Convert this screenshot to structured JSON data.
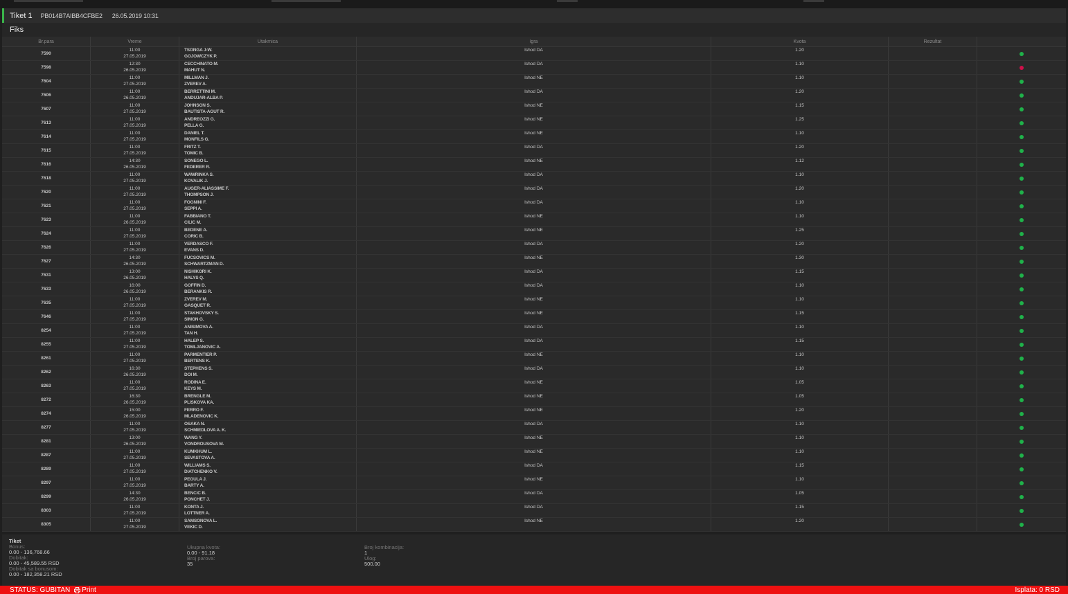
{
  "ticket": {
    "title": "Tiket 1",
    "code": "PB014B7AIBB4CFBE2",
    "date": "26.05.2019 10:31",
    "section": "Fiks"
  },
  "columns": [
    "Br.para",
    "Vreme",
    "Utakmica",
    "Igra",
    "Kvota",
    "Rezultat",
    ""
  ],
  "rows": [
    {
      "num": "7590",
      "time": "11:00",
      "date": "27.05.2019",
      "p1": "TSONGA J-W.",
      "p2": "GOJOWCZYK P.",
      "game": "Ishod DA",
      "odds": "1.20",
      "result": "won"
    },
    {
      "num": "7598",
      "time": "12:30",
      "date": "26.05.2019",
      "p1": "CECCHINATO M.",
      "p2": "MAHUT N.",
      "game": "Ishod DA",
      "odds": "1.10",
      "result": "lost"
    },
    {
      "num": "7604",
      "time": "11:00",
      "date": "27.05.2019",
      "p1": "MILLMAN J.",
      "p2": "ZVEREV A.",
      "game": "Ishod NE",
      "odds": "1.10",
      "result": "won"
    },
    {
      "num": "7606",
      "time": "11:00",
      "date": "26.05.2019",
      "p1": "BERRETTINI M.",
      "p2": "ANDUJAR-ALBA P.",
      "game": "Ishod DA",
      "odds": "1.20",
      "result": "won"
    },
    {
      "num": "7607",
      "time": "11:00",
      "date": "27.05.2019",
      "p1": "JOHNSON S.",
      "p2": "BAUTISTA-AGUT R.",
      "game": "Ishod NE",
      "odds": "1.15",
      "result": "won"
    },
    {
      "num": "7613",
      "time": "11:00",
      "date": "27.05.2019",
      "p1": "ANDREOZZI G.",
      "p2": "PELLA G.",
      "game": "Ishod NE",
      "odds": "1.25",
      "result": "won"
    },
    {
      "num": "7614",
      "time": "11:00",
      "date": "27.05.2019",
      "p1": "DANIEL T.",
      "p2": "MONFILS G.",
      "game": "Ishod NE",
      "odds": "1.10",
      "result": "won"
    },
    {
      "num": "7615",
      "time": "11:00",
      "date": "27.05.2019",
      "p1": "FRITZ T.",
      "p2": "TOMIC B.",
      "game": "Ishod DA",
      "odds": "1.20",
      "result": "won"
    },
    {
      "num": "7616",
      "time": "14:30",
      "date": "26.05.2019",
      "p1": "SONEGO L.",
      "p2": "FEDERER R.",
      "game": "Ishod NE",
      "odds": "1.12",
      "result": "won"
    },
    {
      "num": "7618",
      "time": "11:00",
      "date": "27.05.2019",
      "p1": "WAWRINKA S.",
      "p2": "KOVALIK J.",
      "game": "Ishod DA",
      "odds": "1.10",
      "result": "won"
    },
    {
      "num": "7620",
      "time": "11:00",
      "date": "27.05.2019",
      "p1": "AUGER-ALIASSIME F.",
      "p2": "THOMPSON J.",
      "game": "Ishod DA",
      "odds": "1.20",
      "result": "won"
    },
    {
      "num": "7621",
      "time": "11:00",
      "date": "27.05.2019",
      "p1": "FOGNINI F.",
      "p2": "SEPPI A.",
      "game": "Ishod DA",
      "odds": "1.10",
      "result": "won"
    },
    {
      "num": "7623",
      "time": "11:00",
      "date": "26.05.2019",
      "p1": "FABBIANO T.",
      "p2": "CILIC M.",
      "game": "Ishod NE",
      "odds": "1.10",
      "result": "won"
    },
    {
      "num": "7624",
      "time": "11:00",
      "date": "27.05.2019",
      "p1": "BEDENE A.",
      "p2": "CORIC B.",
      "game": "Ishod NE",
      "odds": "1.25",
      "result": "won"
    },
    {
      "num": "7626",
      "time": "11:00",
      "date": "27.05.2019",
      "p1": "VERDASCO F.",
      "p2": "EVANS D.",
      "game": "Ishod DA",
      "odds": "1.20",
      "result": "won"
    },
    {
      "num": "7627",
      "time": "14:30",
      "date": "26.05.2019",
      "p1": "FUCSOVICS M.",
      "p2": "SCHWARTZMAN D.",
      "game": "Ishod NE",
      "odds": "1.30",
      "result": "won"
    },
    {
      "num": "7631",
      "time": "13:00",
      "date": "26.05.2019",
      "p1": "NISHIKORI K.",
      "p2": "HALYS Q.",
      "game": "Ishod DA",
      "odds": "1.15",
      "result": "won"
    },
    {
      "num": "7633",
      "time": "16:00",
      "date": "26.05.2019",
      "p1": "GOFFIN D.",
      "p2": "BERANKIS R.",
      "game": "Ishod DA",
      "odds": "1.10",
      "result": "won"
    },
    {
      "num": "7635",
      "time": "11:00",
      "date": "27.05.2019",
      "p1": "ZVEREV M.",
      "p2": "GASQUET R.",
      "game": "Ishod NE",
      "odds": "1.10",
      "result": "won"
    },
    {
      "num": "7646",
      "time": "11:00",
      "date": "27.05.2019",
      "p1": "STAKHOVSKY S.",
      "p2": "SIMON G.",
      "game": "Ishod NE",
      "odds": "1.15",
      "result": "won"
    },
    {
      "num": "8254",
      "time": "11:00",
      "date": "27.05.2019",
      "p1": "ANISIMOVA A.",
      "p2": "TAN H.",
      "game": "Ishod DA",
      "odds": "1.10",
      "result": "won"
    },
    {
      "num": "8255",
      "time": "11:00",
      "date": "27.05.2019",
      "p1": "HALEP S.",
      "p2": "TOMLJANOVIC A.",
      "game": "Ishod DA",
      "odds": "1.15",
      "result": "won"
    },
    {
      "num": "8261",
      "time": "11:00",
      "date": "27.05.2019",
      "p1": "PARMENTIER P.",
      "p2": "BERTENS K.",
      "game": "Ishod NE",
      "odds": "1.10",
      "result": "won"
    },
    {
      "num": "8262",
      "time": "16:30",
      "date": "26.05.2019",
      "p1": "STEPHENS S.",
      "p2": "DOI M.",
      "game": "Ishod DA",
      "odds": "1.10",
      "result": "won"
    },
    {
      "num": "8263",
      "time": "11:00",
      "date": "27.05.2019",
      "p1": "RODINA E.",
      "p2": "KEYS M.",
      "game": "Ishod NE",
      "odds": "1.05",
      "result": "won"
    },
    {
      "num": "8272",
      "time": "16:30",
      "date": "26.05.2019",
      "p1": "BRENGLE M.",
      "p2": "PLISKOVA KA.",
      "game": "Ishod NE",
      "odds": "1.05",
      "result": "won"
    },
    {
      "num": "8274",
      "time": "15:00",
      "date": "26.05.2019",
      "p1": "FERRO F.",
      "p2": "MLADENOVIC K.",
      "game": "Ishod NE",
      "odds": "1.20",
      "result": "won"
    },
    {
      "num": "8277",
      "time": "11:00",
      "date": "27.05.2019",
      "p1": "OSAKA N.",
      "p2": "SCHMIEDLOVA A. K.",
      "game": "Ishod DA",
      "odds": "1.10",
      "result": "won"
    },
    {
      "num": "8281",
      "time": "13:00",
      "date": "26.05.2019",
      "p1": "WANG Y.",
      "p2": "VONDROUSOVA M.",
      "game": "Ishod NE",
      "odds": "1.10",
      "result": "won"
    },
    {
      "num": "8287",
      "time": "11:00",
      "date": "27.05.2019",
      "p1": "KUMKHUM L.",
      "p2": "SEVASTOVA A.",
      "game": "Ishod NE",
      "odds": "1.10",
      "result": "won"
    },
    {
      "num": "8289",
      "time": "11:00",
      "date": "27.05.2019",
      "p1": "WILLIAMS S.",
      "p2": "DIATCHENKO V.",
      "game": "Ishod DA",
      "odds": "1.15",
      "result": "won"
    },
    {
      "num": "8297",
      "time": "11:00",
      "date": "27.05.2019",
      "p1": "PEGULA J.",
      "p2": "BARTY A.",
      "game": "Ishod NE",
      "odds": "1.10",
      "result": "won"
    },
    {
      "num": "8299",
      "time": "14:30",
      "date": "26.05.2019",
      "p1": "BENCIC B.",
      "p2": "PONCHET J.",
      "game": "Ishod DA",
      "odds": "1.05",
      "result": "won"
    },
    {
      "num": "8303",
      "time": "11:00",
      "date": "27.05.2019",
      "p1": "KONTA J.",
      "p2": "LOTTNER A.",
      "game": "Ishod DA",
      "odds": "1.15",
      "result": "won"
    },
    {
      "num": "8305",
      "time": "11:00",
      "date": "27.05.2019",
      "p1": "SAMSONOVA L.",
      "p2": "VEKIC D.",
      "game": "Ishod NE",
      "odds": "1.20",
      "result": "won"
    }
  ],
  "summary": {
    "title": "Tiket",
    "bonus_label": "Bonus:",
    "bonus_value": "0.00 - 136,768.66",
    "dobitak_label": "Dobitak:",
    "dobitak_value": "0.00 - 45,589.55 RSD",
    "dobitak_bonus_label": "Dobitak sa bonusom:",
    "dobitak_bonus_value": "0.00 - 182,358.21 RSD",
    "ukupna_kvota_label": "Ukupna kvota:",
    "ukupna_kvota_value": "0.00 - 91.18",
    "broj_parova_label": "Broj parova:",
    "broj_parova_value": "35",
    "broj_kombinacija_label": "Broj kombinacija:",
    "broj_kombinacija_value": "1",
    "ulog_label": "Ulog:",
    "ulog_value": "500.00"
  },
  "status": {
    "status_text": "STATUS: GUBITAN",
    "print_label": "Print",
    "payout": "Isplata: 0 RSD"
  },
  "colors": {
    "won": "#1fb24a",
    "lost": "#d0104a",
    "status_bar": "#ee1111",
    "accent": "#3ab54a"
  }
}
